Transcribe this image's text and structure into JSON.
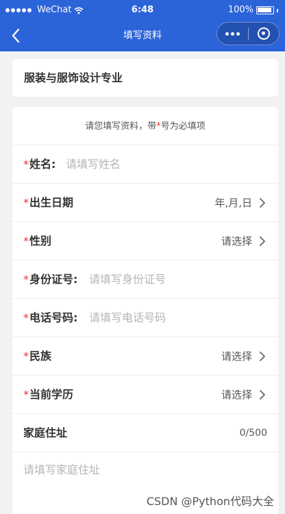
{
  "status_bar": {
    "carrier": "WeChat",
    "time": "6:48",
    "battery": "100%"
  },
  "nav": {
    "title": "填写资料"
  },
  "major": {
    "text": "服装与服饰设计专业"
  },
  "form": {
    "notice_before": "请您填写资料，带",
    "notice_star": "*",
    "notice_after": "号为必填项",
    "required_mark": "*",
    "rows": {
      "name": {
        "label": "姓名:",
        "placeholder": "请填写姓名"
      },
      "birth": {
        "label": "出生日期",
        "value": "年,月,日"
      },
      "gender": {
        "label": "性别",
        "value": "请选择"
      },
      "id": {
        "label": "身份证号:",
        "placeholder": "请填写身份证号"
      },
      "phone": {
        "label": "电话号码:",
        "placeholder": "请填写电话号码"
      },
      "ethnicity": {
        "label": "民族",
        "value": "请选择"
      },
      "education": {
        "label": "当前学历",
        "value": "请选择"
      },
      "address": {
        "label": "家庭住址",
        "counter": "0/500",
        "placeholder": "请填写家庭住址"
      }
    }
  },
  "watermark": "CSDN @Python代码大全",
  "colors": {
    "brand_blue": "#2b63d8",
    "required_red": "#e33333",
    "background": "#f2f2f2"
  }
}
